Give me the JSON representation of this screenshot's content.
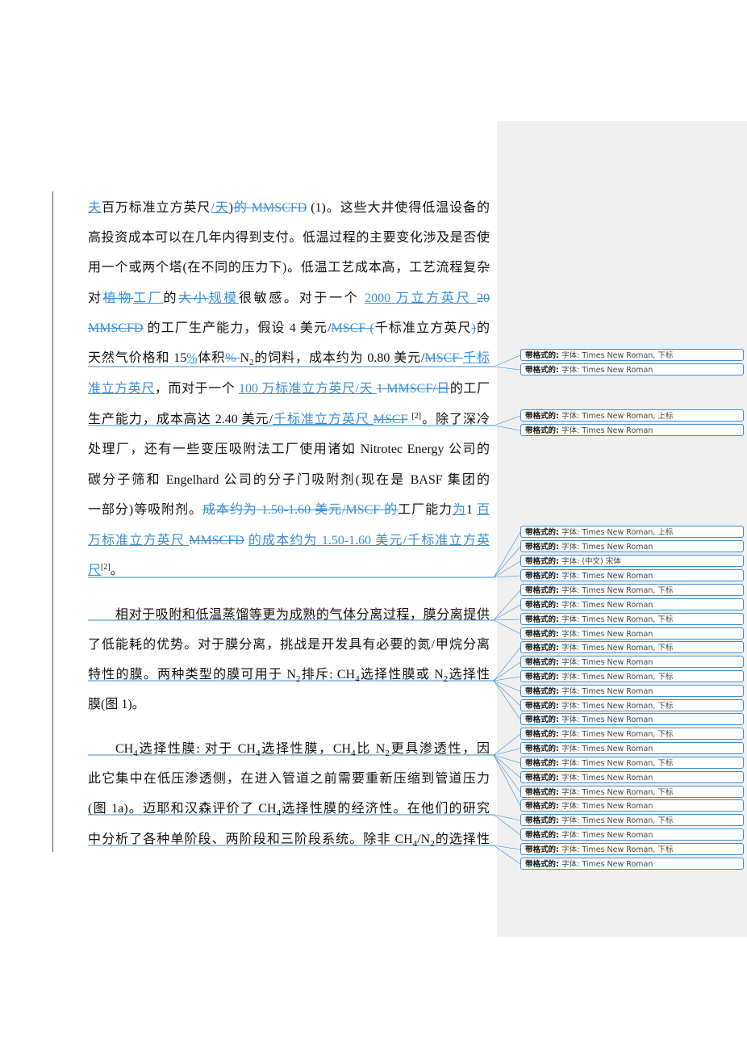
{
  "document": {
    "lines": [
      [
        [
          "ins",
          "夫"
        ],
        [
          "t",
          "百万标准立方英尺"
        ],
        [
          "ins",
          "/天"
        ],
        [
          "t",
          ")"
        ],
        [
          "del",
          "的 MMSCFD"
        ],
        [
          "t",
          " (1)。这些大井使得低温设备的"
        ]
      ],
      [
        [
          "t",
          "高投资成本可以在几年内得到支付。低温过程的主要变化涉及是否使"
        ]
      ],
      [
        [
          "t",
          "用一个或两个塔(在不同的压力下)。低温工艺成本高，工艺流程复杂"
        ]
      ],
      [
        [
          "t",
          "对"
        ],
        [
          "del",
          "植物"
        ],
        [
          "ins",
          "工厂"
        ],
        [
          "t",
          "的"
        ],
        [
          "del",
          "大小"
        ],
        [
          "ins",
          "规模"
        ],
        [
          "t",
          "很敏感。对于一个 "
        ],
        [
          "ins",
          "2000 万立方英尺 "
        ],
        [
          "del",
          "20"
        ]
      ],
      [
        [
          "del",
          "MMSCFD"
        ],
        [
          "t",
          " 的工厂生产能力，假设 4 美元/"
        ],
        [
          "del",
          "MSCF ("
        ],
        [
          "t",
          "千标准立方英尺"
        ],
        [
          "del",
          ")"
        ],
        [
          "t",
          "的"
        ]
      ],
      [
        [
          "t",
          "天然气价格和 15"
        ],
        [
          "ins",
          "%"
        ],
        [
          "t",
          "体积"
        ],
        [
          "del",
          "% "
        ],
        [
          "t",
          "N"
        ],
        [
          "sub",
          "2"
        ],
        [
          "t",
          "的饲料，成本约为 0.80 美元/"
        ],
        [
          "del",
          "MSCF "
        ],
        [
          "ins",
          "千标"
        ]
      ],
      [
        [
          "ins",
          "准立方英尺"
        ],
        [
          "t",
          "，而对于一个 "
        ],
        [
          "ins",
          "100 万标准立方英尺/天 "
        ],
        [
          "del",
          "1 MMSCF/日"
        ],
        [
          "t",
          "的工厂"
        ]
      ],
      [
        [
          "t",
          "生产能力，成本高达 2.40 美元/"
        ],
        [
          "ins",
          "千标准立方英尺 "
        ],
        [
          "del",
          "MSCF"
        ],
        [
          "t",
          " "
        ],
        [
          "sup",
          "[2]"
        ],
        [
          "t",
          "。除了深冷"
        ]
      ],
      [
        [
          "t",
          "处理厂，还有一些变压吸附法工厂使用诸如 Nitrotec Energy 公司的"
        ]
      ],
      [
        [
          "t",
          "碳分子筛和 Engelhard 公司的分子门吸附剂(现在是 BASF 集团的"
        ]
      ],
      [
        [
          "t",
          "一部分)等吸附剂。"
        ],
        [
          "del",
          "成本约为 1.50-1.60 美元/MSCF 的"
        ],
        [
          "t",
          "工厂能力"
        ],
        [
          "ins",
          "为"
        ],
        [
          "t",
          "1 "
        ],
        [
          "ins",
          "百"
        ]
      ],
      [
        [
          "ins",
          "万标准立方英尺 "
        ],
        [
          "del",
          "MMSCFD"
        ],
        [
          "t",
          " "
        ],
        [
          "ins",
          "的成本约为 1.50-1.60 美元/千标准立方英"
        ]
      ],
      [
        [
          "ins",
          "尺"
        ],
        [
          "sup",
          "[2]"
        ],
        [
          "t",
          "。"
        ]
      ],
      [
        [
          "t",
          "相对于吸附和低温蒸馏等更为成熟的气体分离过程，膜分离提供"
        ]
      ],
      [
        [
          "t",
          "了低能耗的优势。对于膜分离，挑战是开发具有必要的氮/甲烷分离"
        ]
      ],
      [
        [
          "t",
          "特性的膜。两种类型的膜可用于 N"
        ],
        [
          "sub",
          "2"
        ],
        [
          "t",
          "排斥: CH"
        ],
        [
          "sub",
          "4"
        ],
        [
          "t",
          "选择性膜或 N"
        ],
        [
          "sub",
          "2"
        ],
        [
          "t",
          "选择性"
        ]
      ],
      [
        [
          "t",
          "膜(图 1)。"
        ]
      ],
      [
        [
          "t",
          "CH"
        ],
        [
          "sub",
          "4"
        ],
        [
          "t",
          "选择性膜: 对于 CH"
        ],
        [
          "sub",
          "4"
        ],
        [
          "t",
          "选择性膜，CH"
        ],
        [
          "sub",
          "4"
        ],
        [
          "t",
          "比 N"
        ],
        [
          "sub",
          "2"
        ],
        [
          "t",
          "更具渗透性，因"
        ]
      ],
      [
        [
          "t",
          "此它集中在低压渗透侧，在进入管道之前需要重新压缩到管道压力"
        ]
      ],
      [
        [
          "t",
          "(图 1a)。迈耶和汉森评价了 CH"
        ],
        [
          "sub",
          "4"
        ],
        [
          "t",
          "选择性膜的经济性。在他们的研究"
        ]
      ],
      [
        [
          "t",
          "中分析了各种单阶段、两阶段和三阶段系统。除非 CH"
        ],
        [
          "sub",
          "4"
        ],
        [
          "t",
          "/N"
        ],
        [
          "sub",
          "2"
        ],
        [
          "t",
          "的选择性"
        ]
      ]
    ]
  },
  "comments": {
    "prefix": "带格式的:",
    "items": [
      "字体: Times New Roman, 下标",
      "字体: Times New Roman",
      "字体: Times New Roman, 上标",
      "字体: Times New Roman",
      "字体: Times New Roman, 上标",
      "字体: Times New Roman",
      "字体: (中文) 宋体",
      "字体: Times New Roman",
      "字体: Times New Roman, 下标",
      "字体: Times New Roman",
      "字体: Times New Roman, 下标",
      "字体: Times New Roman",
      "字体: Times New Roman, 下标",
      "字体: Times New Roman",
      "字体: Times New Roman, 下标",
      "字体: Times New Roman",
      "字体: Times New Roman, 下标",
      "字体: Times New Roman",
      "字体: Times New Roman, 下标",
      "字体: Times New Roman",
      "字体: Times New Roman, 下标",
      "字体: Times New Roman",
      "字体: Times New Roman, 下标",
      "字体: Times New Roman",
      "字体: Times New Roman, 下标",
      "字体: Times New Roman",
      "字体: Times New Roman, 下标",
      "字体: Times New Roman"
    ]
  },
  "colors": {
    "revision": "#3a8fd6",
    "pane": "#f0f0f0"
  }
}
